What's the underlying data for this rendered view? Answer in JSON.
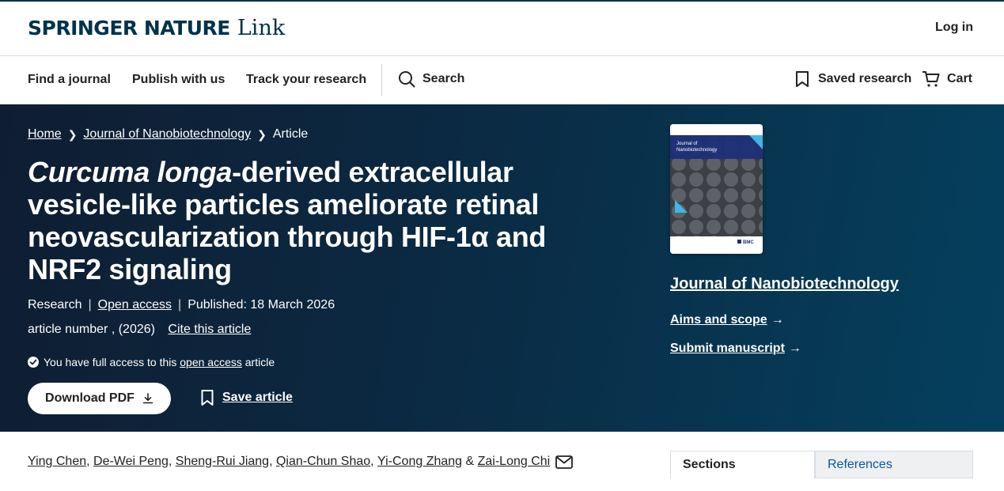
{
  "header": {
    "logo_main": "SPRINGER NATURE",
    "logo_link": "Link",
    "login": "Log in"
  },
  "nav": {
    "items": [
      "Find a journal",
      "Publish with us",
      "Track your research"
    ],
    "search": "Search",
    "saved": "Saved research",
    "cart": "Cart"
  },
  "breadcrumb": {
    "home": "Home",
    "journal": "Journal of Nanobiotechnology",
    "current": "Article"
  },
  "article": {
    "title_italic": "Curcuma longa",
    "title_rest": "-derived extracellular vesicle-like particles ameliorate retinal neovascularization through HIF-1α and NRF2 signaling",
    "type": "Research",
    "open_access": "Open access",
    "published": "Published: 18 March 2026",
    "article_number": "article number , (2026)",
    "cite": "Cite this article",
    "access_prefix": "You have full access to this",
    "access_link": "open access",
    "access_suffix": "article",
    "download": "Download PDF",
    "save": "Save article"
  },
  "journal": {
    "name": "Journal of Nanobiotechnology",
    "aims": "Aims and scope",
    "submit": "Submit manuscript",
    "cover_title_line1": "Journal of",
    "cover_title_line2": "Nanobiotechnology",
    "cover_brand": "BMC"
  },
  "authors": {
    "list": [
      "Ying Chen",
      "De-Wei Peng",
      "Sheng-Rui Jiang",
      "Qian-Chun Shao",
      "Yi-Cong Zhang",
      "Zai-Long Chi"
    ],
    "comma": ", ",
    "amp": " & "
  },
  "tabs": {
    "sections": "Sections",
    "references": "References"
  },
  "colors": {
    "brand": "#01324b",
    "hero_start": "#0f1d32",
    "hero_end": "#04405e",
    "link_blue": "#0a56a3"
  }
}
